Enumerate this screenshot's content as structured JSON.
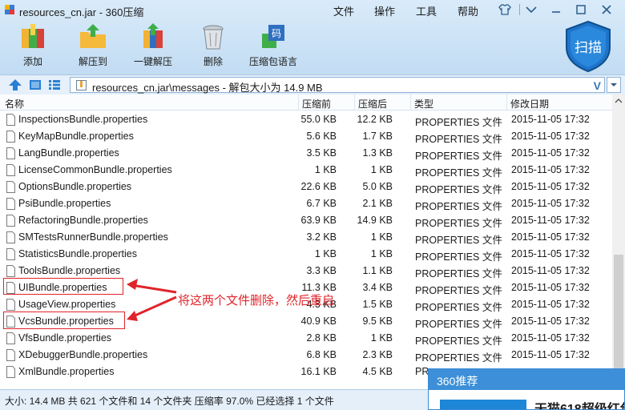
{
  "window": {
    "title": "resources_cn.jar - 360压缩"
  },
  "menu": [
    "文件",
    "操作",
    "工具",
    "帮助"
  ],
  "toolbar": {
    "tools": [
      {
        "label": "添加",
        "icon": "add-archive-icon"
      },
      {
        "label": "解压到",
        "icon": "extract-to-icon"
      },
      {
        "label": "一键解压",
        "icon": "one-click-extract-icon"
      },
      {
        "label": "删除",
        "icon": "trash-can-icon"
      },
      {
        "label": "压缩包语言",
        "icon": "archive-language-icon"
      }
    ],
    "scan_label": "扫描"
  },
  "address": {
    "path": "resources_cn.jar\\messages - 解包大小为 14.9 MB",
    "v_glyph": "V"
  },
  "table": {
    "headers": {
      "name": "名称",
      "compressed": "压缩前",
      "original": "压缩后",
      "type": "类型",
      "modified": "修改日期"
    },
    "rows": [
      {
        "name": "InspectionsBundle.properties",
        "comp": "55.0 KB",
        "orig": "12.2 KB",
        "type": "PROPERTIES 文件",
        "date": "2015-11-05 17:32"
      },
      {
        "name": "KeyMapBundle.properties",
        "comp": "5.6 KB",
        "orig": "1.7 KB",
        "type": "PROPERTIES 文件",
        "date": "2015-11-05 17:32"
      },
      {
        "name": "LangBundle.properties",
        "comp": "3.5 KB",
        "orig": "1.3 KB",
        "type": "PROPERTIES 文件",
        "date": "2015-11-05 17:32"
      },
      {
        "name": "LicenseCommonBundle.properties",
        "comp": "1 KB",
        "orig": "1 KB",
        "type": "PROPERTIES 文件",
        "date": "2015-11-05 17:32"
      },
      {
        "name": "OptionsBundle.properties",
        "comp": "22.6 KB",
        "orig": "5.0 KB",
        "type": "PROPERTIES 文件",
        "date": "2015-11-05 17:32"
      },
      {
        "name": "PsiBundle.properties",
        "comp": "6.7 KB",
        "orig": "2.1 KB",
        "type": "PROPERTIES 文件",
        "date": "2015-11-05 17:32"
      },
      {
        "name": "RefactoringBundle.properties",
        "comp": "63.9 KB",
        "orig": "14.9 KB",
        "type": "PROPERTIES 文件",
        "date": "2015-11-05 17:32"
      },
      {
        "name": "SMTestsRunnerBundle.properties",
        "comp": "3.2 KB",
        "orig": "1 KB",
        "type": "PROPERTIES 文件",
        "date": "2015-11-05 17:32"
      },
      {
        "name": "StatisticsBundle.properties",
        "comp": "1 KB",
        "orig": "1 KB",
        "type": "PROPERTIES 文件",
        "date": "2015-11-05 17:32"
      },
      {
        "name": "ToolsBundle.properties",
        "comp": "3.3 KB",
        "orig": "1.1 KB",
        "type": "PROPERTIES 文件",
        "date": "2015-11-05 17:32"
      },
      {
        "name": "UIBundle.properties",
        "comp": "11.3 KB",
        "orig": "3.4 KB",
        "type": "PROPERTIES 文件",
        "date": "2015-11-05 17:32"
      },
      {
        "name": "UsageView.properties",
        "comp": "4.3 KB",
        "orig": "1.5 KB",
        "type": "PROPERTIES 文件",
        "date": "2015-11-05 17:32"
      },
      {
        "name": "VcsBundle.properties",
        "comp": "40.9 KB",
        "orig": "9.5 KB",
        "type": "PROPERTIES 文件",
        "date": "2015-11-05 17:32"
      },
      {
        "name": "VfsBundle.properties",
        "comp": "2.8 KB",
        "orig": "1 KB",
        "type": "PROPERTIES 文件",
        "date": "2015-11-05 17:32"
      },
      {
        "name": "XDebuggerBundle.properties",
        "comp": "6.8 KB",
        "orig": "2.3 KB",
        "type": "PROPERTIES 文件",
        "date": "2015-11-05 17:32"
      },
      {
        "name": "XmlBundle.properties",
        "comp": "16.1 KB",
        "orig": "4.5 KB",
        "type": "PR",
        "date": ""
      }
    ]
  },
  "annotation": {
    "text": "将这两个文件删除，然后重启",
    "color": "#e0242b"
  },
  "status": {
    "text": "大小: 14.4 MB 共 621 个文件和 14 个文件夹 压缩率 97.0% 已经选择 1 个文件"
  },
  "popup": {
    "title": "360推荐",
    "ad_text": "天猫618超级红包"
  },
  "colors": {
    "accent": "#3c8fd8",
    "annotation_red": "#e0242b",
    "frame_blue": "#c2dcf3"
  }
}
